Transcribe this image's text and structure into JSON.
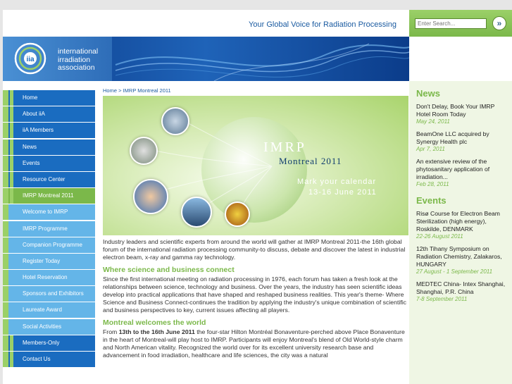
{
  "header": {
    "tagline": "Your Global Voice for Radiation Processing",
    "search_placeholder": "Enter Search...",
    "search_button_icon": "chevron-double-right-icon"
  },
  "logo": {
    "line1": "international",
    "line2": "irradiation",
    "line3": "association",
    "mark": "iia"
  },
  "sidebar": {
    "items": [
      {
        "label": "Home"
      },
      {
        "label": "About iiA"
      },
      {
        "label": "iiA Members"
      },
      {
        "label": "News"
      },
      {
        "label": "Events"
      },
      {
        "label": "Resource Center"
      },
      {
        "label": "IMRP Montreal 2011"
      },
      {
        "label": "Welcome to IMRP"
      },
      {
        "label": "IMRP Programme"
      },
      {
        "label": "Companion Programme"
      },
      {
        "label": "Register Today"
      },
      {
        "label": "Hotel Reservation"
      },
      {
        "label": "Sponsors and Exhibitors"
      },
      {
        "label": "Laureate Award"
      },
      {
        "label": "Social Activities"
      },
      {
        "label": "Members-Only"
      },
      {
        "label": "Contact Us"
      }
    ]
  },
  "breadcrumb": {
    "home": "Home",
    "sep": ">",
    "current": "IMRP Montreal 2011"
  },
  "hero": {
    "title": "IMRP",
    "city": "Montreal 2011",
    "mark": "Mark your calendar",
    "dates": "13-16 June 2011"
  },
  "main": {
    "intro": "Industry leaders and scientific experts from around the world will gather at IMRP Montreal 2011-the 16th global forum of the international radiation processing community-to discuss, debate and discover the latest in industrial electron beam, x-ray and gamma ray technology.",
    "section1_heading": "Where science and business connect",
    "section1_body": "Since the first international meeting on radiation processing in 1976, each forum has taken a fresh look at the relationships between science, technology and business. Over the years, the industry has seen scientific ideas develop into practical applications that have shaped and reshaped business realities. This year's theme- Where Science and Business Connect-continues the tradition by applying the industry's unique combination of scientific and business perspectives to key, current issues affecting all players.",
    "section2_heading": "Montreal welcomes the world",
    "section2_from": "From ",
    "section2_dates": "13th to the 16th June 2011",
    "section2_body": " the four-star Hilton Montréal Bonaventure-perched above Place Bonaventure in the heart of Montreal-will play host to IMRP. Participants will enjoy Montreal's blend of Old World-style charm and North American vitality. Recognized the world over for its excellent university research base and advancement in food irradiation, healthcare and life sciences, the city was a natural"
  },
  "news": {
    "heading": "News",
    "items": [
      {
        "title": "Don't Delay, Book Your IMRP Hotel Room Today",
        "date": "May 24, 2011"
      },
      {
        "title": "BeamOne LLC acquired by Synergy Health plc",
        "date": "Apr 7, 2011"
      },
      {
        "title": "An extensive review of the phytosanitary application of irradiation...",
        "date": "Feb 28, 2011"
      }
    ]
  },
  "events": {
    "heading": "Events",
    "items": [
      {
        "title": "Risø Course for Electron Beam Sterilization (high energy), Roskilde, DENMARK",
        "date": "22-26 August 2011"
      },
      {
        "title": "12th Tihany Symposium on Radiation Chemistry, Zalakaros, HUNGARY",
        "date": "27 August - 1 September 2011"
      },
      {
        "title": "MEDTEC China- Intex Shanghai, Shanghai, P.R. China",
        "date": "7-8 September 2011"
      }
    ]
  },
  "colors": {
    "nav_blue": "#1a6cc0",
    "nav_light_blue": "#64b5e8",
    "accent_green": "#7bb84a",
    "link_blue": "#1a5aa0"
  }
}
